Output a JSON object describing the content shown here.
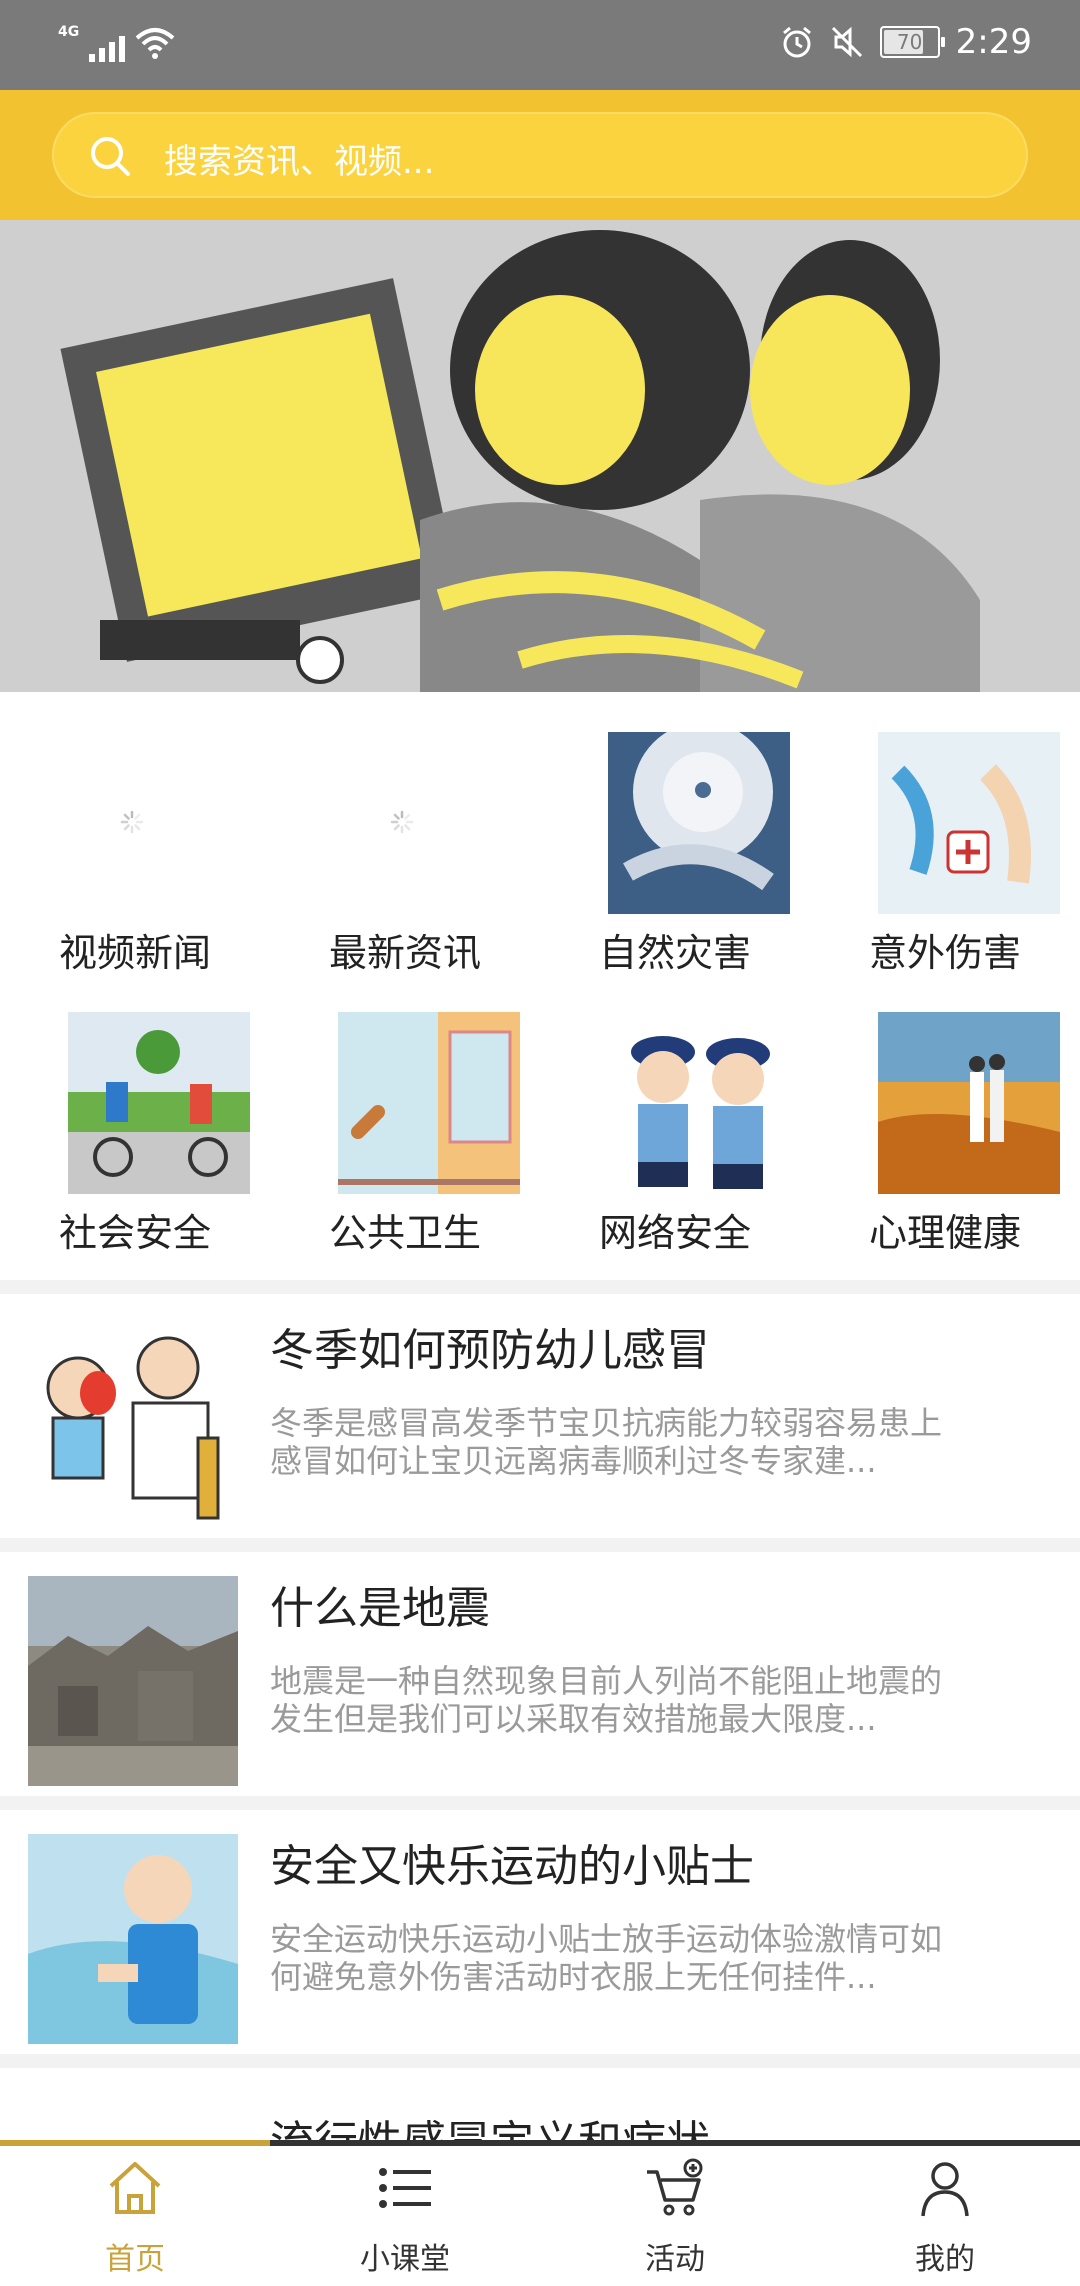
{
  "status": {
    "network": "4G",
    "battery": "70",
    "time": "2:29"
  },
  "search": {
    "placeholder": "搜索资讯、视频..."
  },
  "categories": [
    {
      "label": "视频新闻"
    },
    {
      "label": "最新资讯"
    },
    {
      "label": "自然灾害"
    },
    {
      "label": "意外伤害"
    },
    {
      "label": "社会安全"
    },
    {
      "label": "公共卫生"
    },
    {
      "label": "网络安全"
    },
    {
      "label": "心理健康"
    }
  ],
  "news": [
    {
      "title": "冬季如何预防幼儿感冒",
      "desc": "冬季是感冒高发季节宝贝抗病能力较弱容易患上感冒如何让宝贝远离病毒顺利过冬专家建..."
    },
    {
      "title": "什么是地震",
      "desc": "地震是一种自然现象目前人列尚不能阻止地震的发生但是我们可以采取有效措施最大限度..."
    },
    {
      "title": "安全又快乐运动的小贴士",
      "desc": "安全运动快乐运动小贴士放手运动体验激情可如何避免意外伤害活动时衣服上无任何挂件..."
    },
    {
      "title": "流行性感冒定义和症状"
    }
  ],
  "tabs": [
    {
      "label": "首页"
    },
    {
      "label": "小课堂"
    },
    {
      "label": "活动"
    },
    {
      "label": "我的"
    }
  ],
  "colors": {
    "accent": "#f2c230",
    "tab_active": "#c9a33a"
  }
}
